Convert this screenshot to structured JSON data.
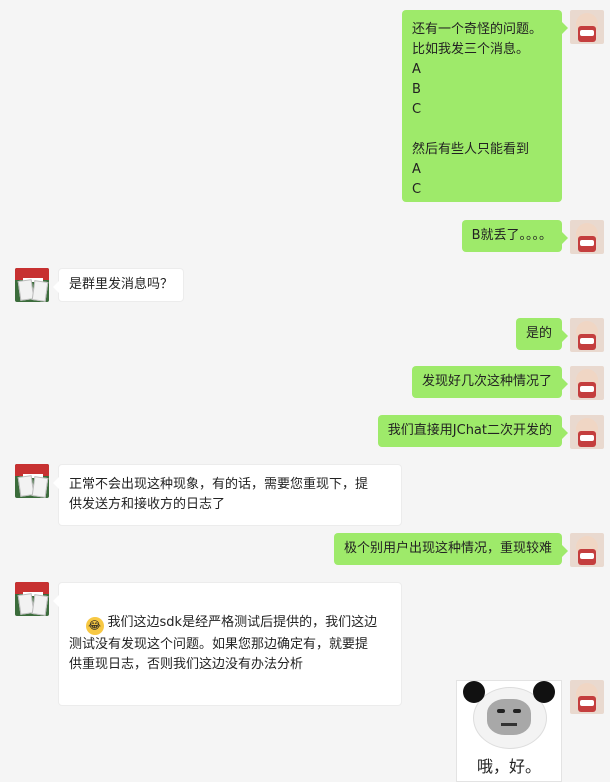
{
  "messages": [
    {
      "side": "me",
      "text": "还有一个奇怪的问题。\n比如我发三个消息。\nA\nB\nC\n\n然后有些人只能看到\nA\nC"
    },
    {
      "side": "me",
      "text": "B就丢了。。。。"
    },
    {
      "side": "them",
      "text": "是群里发消息吗？"
    },
    {
      "side": "me",
      "text": "是的"
    },
    {
      "side": "me",
      "text": "发现好几次这种情况了"
    },
    {
      "side": "me",
      "text": "我们直接用JChat二次开发的"
    },
    {
      "side": "them",
      "text": "正常不会出现这种现象，有的话，需要您重现下，提\n供发送方和接收方的日志了"
    },
    {
      "side": "me",
      "text": "极个别用户出现这种情况，重现较难"
    },
    {
      "side": "them",
      "text": "我们这边sdk是经严格测试后提供的，我们这边\n测试没有发现这个问题。如果您那边确定有，就要提\n供重现日志，否则我们这边没有办法分析",
      "emoji": "😂"
    },
    {
      "side": "me",
      "sticker_caption": "哦，好。"
    }
  ]
}
